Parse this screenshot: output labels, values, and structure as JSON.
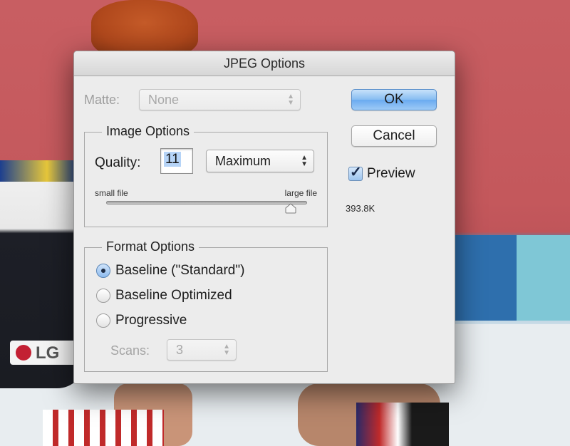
{
  "dialog": {
    "title": "JPEG Options",
    "matte": {
      "label": "Matte:",
      "value": "None"
    },
    "buttons": {
      "ok": "OK",
      "cancel": "Cancel"
    },
    "preview": {
      "label": "Preview",
      "checked": true
    },
    "file_size": "393.8K",
    "image_options": {
      "title": "Image Options",
      "quality_label": "Quality:",
      "quality_value": "11",
      "quality_preset": "Maximum",
      "small_file_label": "small file",
      "large_file_label": "large file",
      "slider_fraction": 0.917
    },
    "format_options": {
      "title": "Format Options",
      "options": [
        {
          "label": "Baseline (\"Standard\")",
          "selected": true
        },
        {
          "label": "Baseline Optimized",
          "selected": false
        },
        {
          "label": "Progressive",
          "selected": false
        }
      ],
      "scans_label": "Scans:",
      "scans_value": "3"
    }
  },
  "background": {
    "logo_text": "LG"
  }
}
